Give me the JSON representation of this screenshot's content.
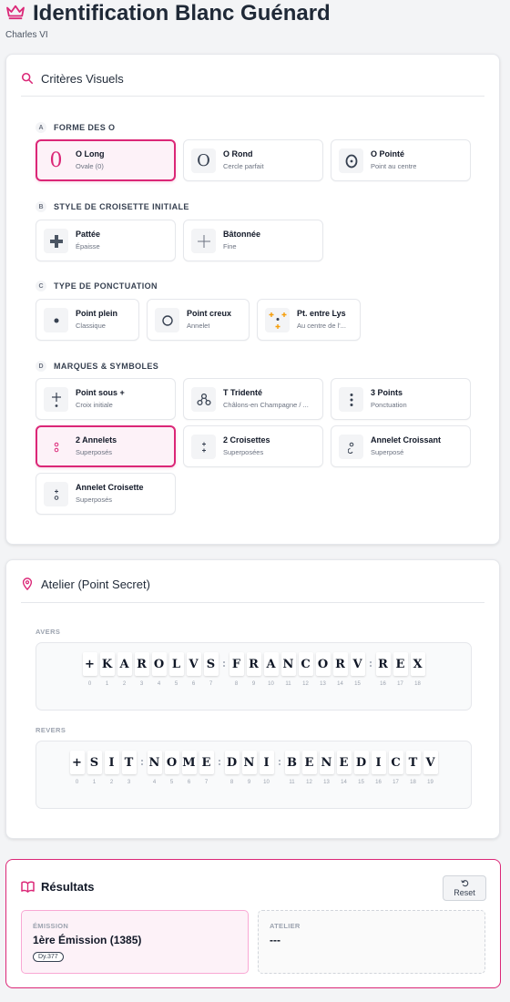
{
  "header": {
    "title": "Identification Blanc Guénard",
    "subtitle": "Charles VI"
  },
  "criteria": {
    "title": "Critères Visuels",
    "sections": [
      {
        "letter": "A",
        "title": "FORME DES O",
        "options": [
          {
            "label": "O Long",
            "sub": "Ovale (0)",
            "icon": "0",
            "selected": true
          },
          {
            "label": "O Rond",
            "sub": "Cercle parfait",
            "icon": "O",
            "selected": false
          },
          {
            "label": "O Pointé",
            "sub": "Point au centre",
            "icon": "ʘ",
            "selected": false
          }
        ]
      },
      {
        "letter": "B",
        "title": "STYLE DE CROISETTE INITIALE",
        "options": [
          {
            "label": "Pattée",
            "sub": "Épaisse",
            "icon": "✚",
            "selected": false
          },
          {
            "label": "Bâtonnée",
            "sub": "Fine",
            "icon": "+",
            "selected": false
          }
        ]
      },
      {
        "letter": "C",
        "title": "TYPE DE PONCTUATION",
        "options": [
          {
            "label": "Point plein",
            "sub": "Classique",
            "icon": "•",
            "selected": false
          },
          {
            "label": "Point creux",
            "sub": "Annelet",
            "icon": "○",
            "selected": false
          },
          {
            "label": "Pt. entre Lys",
            "sub": "Au centre de l'...",
            "icon": "lys",
            "selected": false
          }
        ]
      },
      {
        "letter": "D",
        "title": "MARQUES & SYMBOLES",
        "options": [
          {
            "label": "Point sous +",
            "sub": "Croix initiale",
            "icon": "+.",
            "selected": false
          },
          {
            "label": "T Tridenté",
            "sub": "Châlons-en Champagne / ...",
            "icon": "trident",
            "selected": false
          },
          {
            "label": "3 Points",
            "sub": "Ponctuation",
            "icon": "⋮",
            "selected": false
          },
          {
            "label": "2 Annelets",
            "sub": "Superposés",
            "icon": "°°",
            "selected": true
          },
          {
            "label": "2 Croisettes",
            "sub": "Superposées",
            "icon": "++",
            "selected": false
          },
          {
            "label": "Annelet Croissant",
            "sub": "Superposé",
            "icon": "°(",
            "selected": false
          },
          {
            "label": "Annelet Croisette",
            "sub": "Superposés",
            "icon": "+°",
            "selected": false
          }
        ]
      }
    ]
  },
  "atelier": {
    "title": "Atelier (Point Secret)",
    "avers": {
      "label": "AVERS",
      "chars": [
        "+",
        "K",
        "A",
        "R",
        "O",
        "L",
        "V",
        "S",
        "|",
        "F",
        "R",
        "A",
        "N",
        "C",
        "O",
        "R",
        "V",
        "|",
        "R",
        "E",
        "X"
      ],
      "indices": [
        "0",
        "1",
        "2",
        "3",
        "4",
        "5",
        "6",
        "7",
        "",
        "8",
        "9",
        "10",
        "11",
        "12",
        "13",
        "14",
        "15",
        "",
        "16",
        "17",
        "18"
      ]
    },
    "revers": {
      "label": "REVERS",
      "chars": [
        "+",
        "S",
        "I",
        "T",
        "|",
        "N",
        "O",
        "M",
        "E",
        "|",
        "D",
        "N",
        "I",
        "|",
        "B",
        "E",
        "N",
        "E",
        "D",
        "I",
        "C",
        "T",
        "V"
      ],
      "indices": [
        "0",
        "1",
        "2",
        "3",
        "",
        "4",
        "5",
        "6",
        "7",
        "",
        "8",
        "9",
        "10",
        "",
        "11",
        "12",
        "13",
        "14",
        "15",
        "16",
        "17",
        "18",
        "19"
      ]
    }
  },
  "results": {
    "title": "Résultats",
    "reset_label": "Reset",
    "emission": {
      "key": "ÉMISSION",
      "value": "1ère Émission (1385)",
      "badge": "Dy.377"
    },
    "atelier": {
      "key": "ATELIER",
      "value": "---"
    }
  },
  "colors": {
    "accent": "#db2777",
    "accent_bg": "#fdf2f8"
  }
}
